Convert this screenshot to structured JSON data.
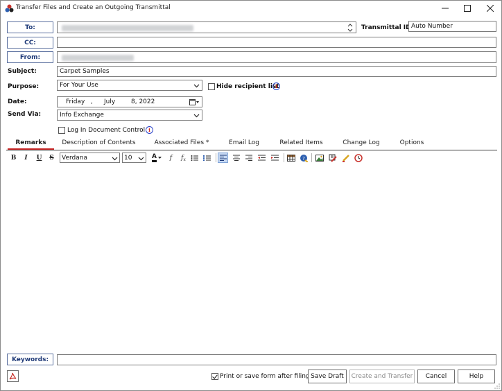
{
  "window": {
    "title": "Transfer Files and Create an Outgoing Transmittal",
    "controls": [
      "minimize",
      "maximize",
      "close"
    ]
  },
  "form": {
    "to_button": "To:",
    "cc_button": "CC:",
    "from_button": "From:",
    "transmittal_id_label": "Transmittal ID:",
    "transmittal_id_value": "Auto Number",
    "subject_label": "Subject:",
    "subject_value": "Carpet Samples",
    "purpose_label": "Purpose:",
    "purpose_value": "For Your Use",
    "hide_recipient_label": "Hide recipient list",
    "date_label": "Date:",
    "date_weekday": "Friday",
    "date_comma1": ",",
    "date_month": "July",
    "date_day_year": "8, 2022",
    "send_via_label": "Send Via:",
    "send_via_value": "Info Exchange",
    "log_in_doc_control_label": "Log In Document Control"
  },
  "tabs": [
    {
      "label": "Remarks",
      "active": true
    },
    {
      "label": "Description of Contents",
      "active": false
    },
    {
      "label": "Associated Files *",
      "active": false
    },
    {
      "label": "Email Log",
      "active": false
    },
    {
      "label": "Related Items",
      "active": false
    },
    {
      "label": "Change Log",
      "active": false
    },
    {
      "label": "Options",
      "active": false
    }
  ],
  "toolbar": {
    "bold": "B",
    "italic": "I",
    "underline": "U",
    "strike": "S",
    "font_name": "Verdana",
    "font_size": "10",
    "font_color_glyph": "A",
    "function_glyph": "f",
    "function_x_glyph": "f"
  },
  "footer": {
    "keywords_button": "Keywords:",
    "print_save_label": "Print or save form after filing",
    "save_draft": "Save Draft",
    "create_transfer": "Create and Transfer",
    "cancel": "Cancel",
    "help": "Help"
  },
  "colors": {
    "field_button_text": "#1f3a78",
    "active_tab_underline": "#cc2a2a",
    "info_icon_ring": "#2b43c9",
    "info_icon_mark": "#d9261c"
  }
}
